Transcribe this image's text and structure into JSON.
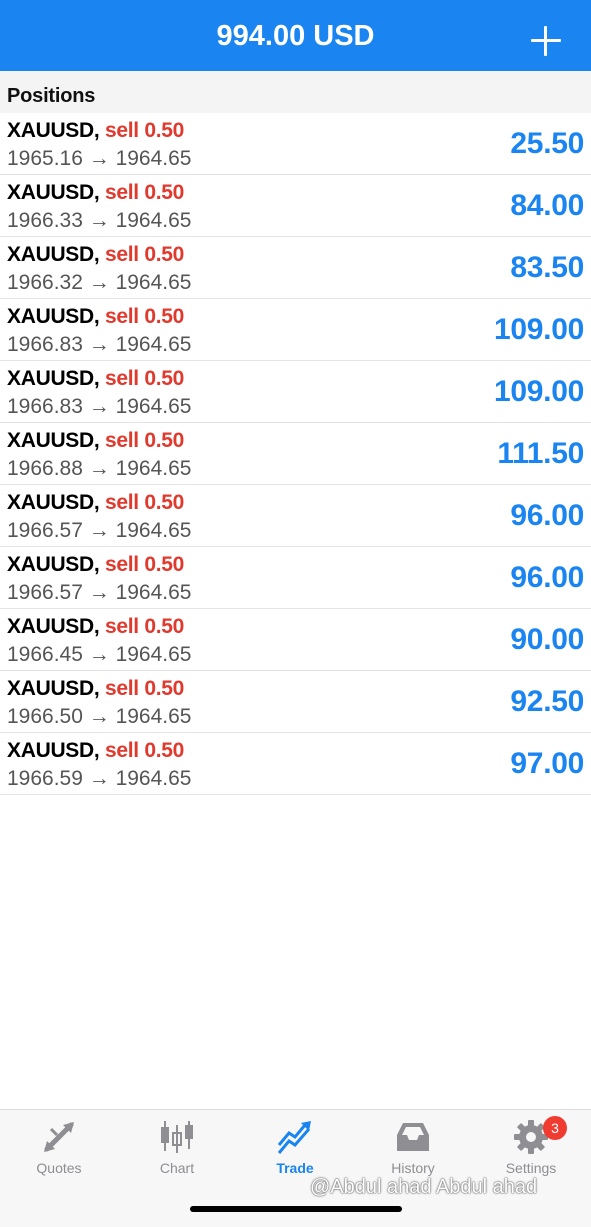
{
  "header": {
    "title": "994.00 USD",
    "add_icon": "plus-icon"
  },
  "section": {
    "label": "Positions"
  },
  "positions": [
    {
      "symbol": "XAUUSD,",
      "side": "sell 0.50",
      "prices": "1965.16 → 1964.65",
      "profit": "25.50"
    },
    {
      "symbol": "XAUUSD,",
      "side": "sell 0.50",
      "prices": "1966.33 → 1964.65",
      "profit": "84.00"
    },
    {
      "symbol": "XAUUSD,",
      "side": "sell 0.50",
      "prices": "1966.32 → 1964.65",
      "profit": "83.50"
    },
    {
      "symbol": "XAUUSD,",
      "side": "sell 0.50",
      "prices": "1966.83 → 1964.65",
      "profit": "109.00"
    },
    {
      "symbol": "XAUUSD,",
      "side": "sell 0.50",
      "prices": "1966.83 → 1964.65",
      "profit": "109.00"
    },
    {
      "symbol": "XAUUSD,",
      "side": "sell 0.50",
      "prices": "1966.88 → 1964.65",
      "profit": "111.50"
    },
    {
      "symbol": "XAUUSD,",
      "side": "sell 0.50",
      "prices": "1966.57 → 1964.65",
      "profit": "96.00"
    },
    {
      "symbol": "XAUUSD,",
      "side": "sell 0.50",
      "prices": "1966.57 → 1964.65",
      "profit": "96.00"
    },
    {
      "symbol": "XAUUSD,",
      "side": "sell 0.50",
      "prices": "1966.45 → 1964.65",
      "profit": "90.00"
    },
    {
      "symbol": "XAUUSD,",
      "side": "sell 0.50",
      "prices": "1966.50 → 1964.65",
      "profit": "92.50"
    },
    {
      "symbol": "XAUUSD,",
      "side": "sell 0.50",
      "prices": "1966.59 → 1964.65",
      "profit": "97.00"
    }
  ],
  "tabs": [
    {
      "label": "Quotes",
      "icon": "quotes-arrows-icon",
      "active": false
    },
    {
      "label": "Chart",
      "icon": "candlestick-chart-icon",
      "active": false
    },
    {
      "label": "Trade",
      "icon": "trade-trend-icon",
      "active": true
    },
    {
      "label": "History",
      "icon": "inbox-tray-icon",
      "active": false
    },
    {
      "label": "Settings",
      "icon": "gear-icon",
      "active": false
    }
  ],
  "settings_badge": "3",
  "watermark": "@Abdul ahad Abdul ahad",
  "colors": {
    "accent": "#1a84f0",
    "sell": "#e03a2e",
    "inactive": "#8e8e93"
  }
}
